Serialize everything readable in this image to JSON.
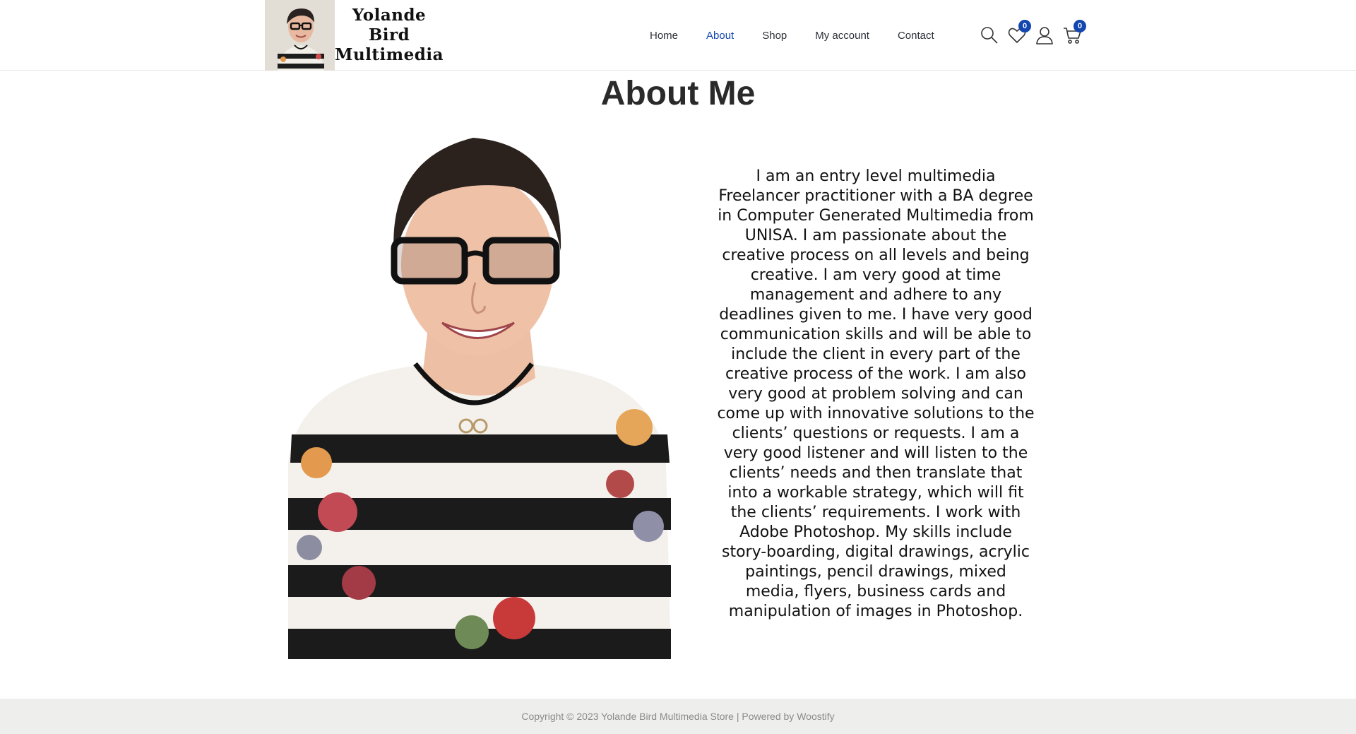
{
  "site": {
    "logo_lines": [
      "Yolande",
      "Bird",
      "Multimedia"
    ]
  },
  "nav": {
    "items": [
      {
        "label": "Home",
        "active": false
      },
      {
        "label": "About",
        "active": true
      },
      {
        "label": "Shop",
        "active": false
      },
      {
        "label": "My account",
        "active": false
      },
      {
        "label": "Contact",
        "active": false
      }
    ]
  },
  "header_icons": {
    "search": "search-icon",
    "wishlist": "heart-icon",
    "wishlist_count": "0",
    "account": "user-icon",
    "cart": "cart-icon",
    "cart_count": "0"
  },
  "page": {
    "title": "About Me",
    "bio": "I am an entry level multimedia Freelancer practitioner with a BA degree in Computer Generated Multimedia from UNISA. I am passionate about the creative process on all levels and being creative. I am very good at time management and adhere to any deadlines given to me. I have very good communication skills and will be able to include the client in every part of the creative process of the work. I am also very good at problem solving and can come up with innovative solutions to the clients’ questions or requests. I am a very good listener and will listen to the clients’ needs and then translate that into a workable strategy, which will fit the clients’ requirements. I work with Adobe Photoshop. My skills include story-boarding, digital drawings, acrylic paintings, pencil drawings, mixed media, flyers, business cards and manipulation of images in Photoshop."
  },
  "footer": {
    "copyright": "Copyright © 2023 Yolande Bird Multimedia Store | Powered by Woostify"
  },
  "colors": {
    "accent": "#1346af",
    "footer_bg": "#eeeeec"
  }
}
